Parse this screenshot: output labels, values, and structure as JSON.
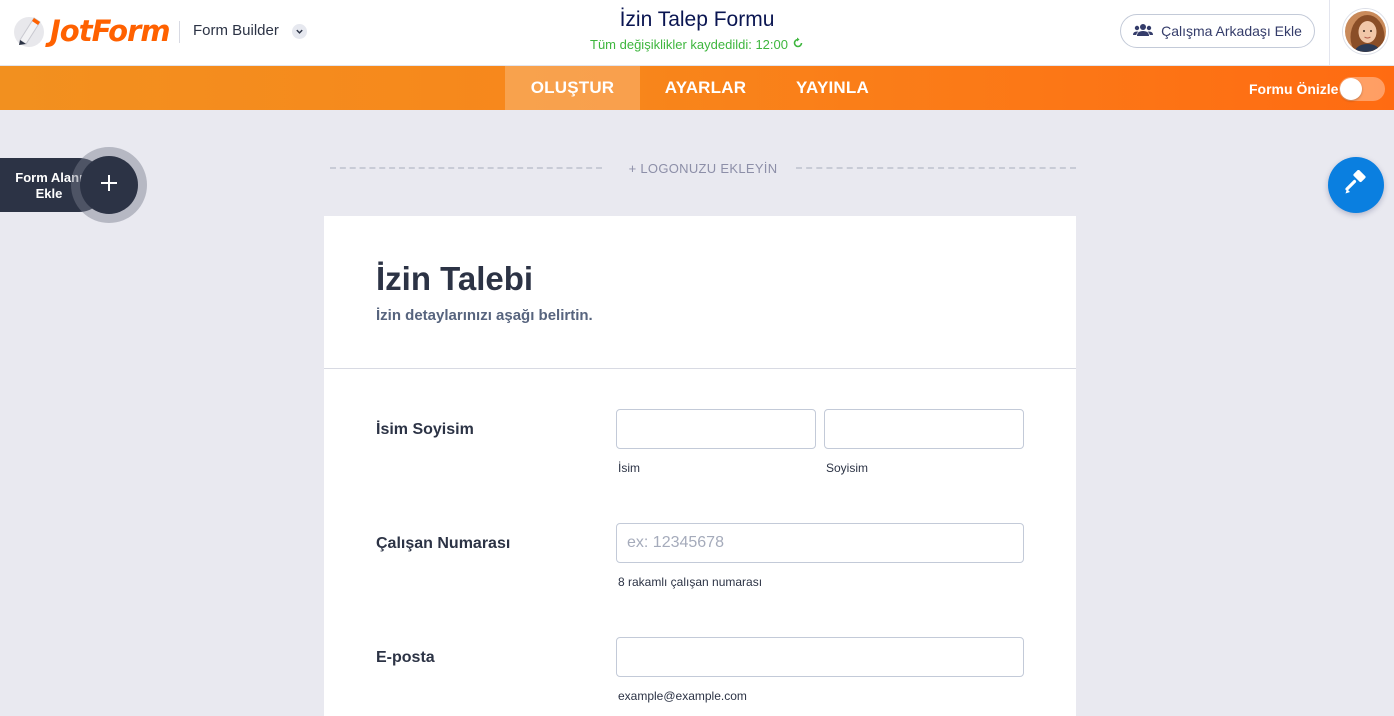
{
  "header": {
    "logo_text": "JotForm",
    "builder_label": "Form Builder",
    "form_name": "İzin Talep Formu",
    "save_status": "Tüm değişiklikler kaydedildi: 12:00",
    "collab_button": "Çalışma Arkadaşı Ekle"
  },
  "nav": {
    "tabs": [
      {
        "label": "OLUŞTUR",
        "active": true
      },
      {
        "label": "AYARLAR",
        "active": false
      },
      {
        "label": "YAYINLA",
        "active": false
      }
    ],
    "preview_label": "Formu Önizle",
    "preview_enabled": false
  },
  "sidebar": {
    "add_element_label": "Form Alanı Ekle"
  },
  "canvas": {
    "add_logo": "+ LOGONUZU EKLEYİN"
  },
  "form": {
    "title": "İzin Talebi",
    "subtitle": "İzin detaylarınızı aşağı belirtin.",
    "fields": {
      "name": {
        "label": "İsim Soyisim",
        "first_sublabel": "İsim",
        "last_sublabel": "Soyisim",
        "first_value": "",
        "last_value": ""
      },
      "employee_no": {
        "label": "Çalışan Numarası",
        "placeholder": "ex: 12345678",
        "sublabel": "8 rakamlı çalışan numarası",
        "value": ""
      },
      "email": {
        "label": "E-posta",
        "sublabel": "example@example.com",
        "value": ""
      }
    }
  },
  "colors": {
    "brand_orange": "#ff6100",
    "nav_orange": "#f8861b",
    "navy": "#2c3345",
    "success_green": "#3eb63e",
    "paint_blue": "#0a7fe0"
  }
}
